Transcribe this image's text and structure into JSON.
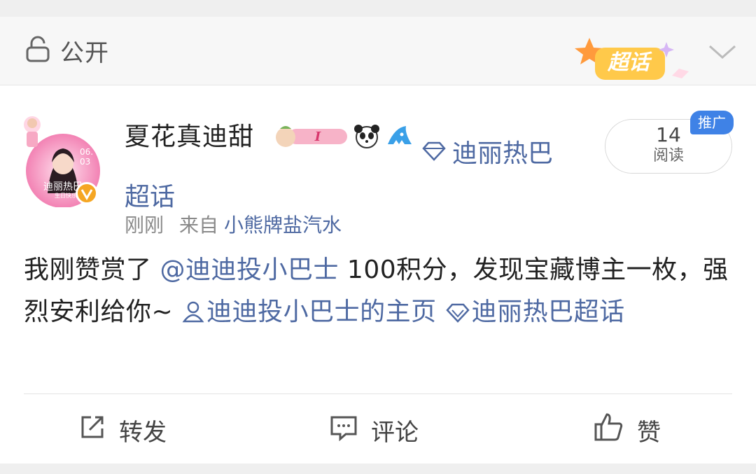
{
  "visibility": {
    "icon": "lock-icon",
    "label": "公开"
  },
  "supertopic_badge": {
    "label": "超话",
    "icon": "supertopic-star-icon"
  },
  "post": {
    "author": {
      "name": "夏花真迪甜",
      "avatar_text": "迪丽热巴",
      "avatar_subtext": "生日快乐",
      "avatar_date": "06.03",
      "verified_icon": "verified-v-icon",
      "badges": [
        "growth-badge-icon",
        "panda-icon",
        "shark-icon"
      ]
    },
    "topic_tag": {
      "line1": "迪丽热巴",
      "line2": "超话",
      "icon": "diamond-icon"
    },
    "read_count": {
      "value": "14",
      "label": "阅读"
    },
    "promo_tag": "推广",
    "meta": {
      "time": "刚刚",
      "source_prefix": "来自",
      "source": "小熊牌盐汽水"
    },
    "body": {
      "text1": "我刚赞赏了 ",
      "mention": "@迪迪投小巴士",
      "text2": " 100积分，发现宝藏博主一枚，强烈安利给你~ ",
      "profile_link": "迪迪投小巴士的主页",
      "topic_link": "迪丽热巴超话"
    },
    "actions": {
      "repost": "转发",
      "comment": "评论",
      "like": "赞"
    }
  },
  "colors": {
    "link": "#4e69a2",
    "promo": "#3f82e6",
    "badge_orange": "#f5a623"
  }
}
